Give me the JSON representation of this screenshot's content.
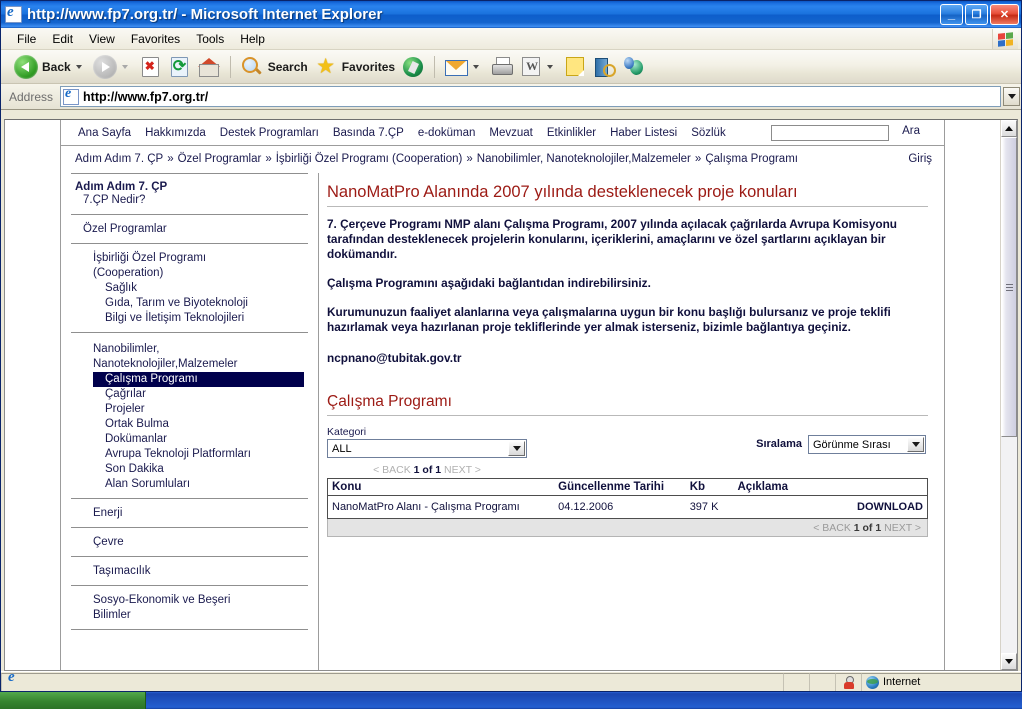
{
  "window": {
    "title": "http://www.fp7.org.tr/ - Microsoft Internet Explorer",
    "icon": "ie-page-icon",
    "minimize_label": "_",
    "maximize_label": "❐",
    "close_label": "✕"
  },
  "menubar": {
    "items": [
      {
        "label": "File"
      },
      {
        "label": "Edit"
      },
      {
        "label": "View"
      },
      {
        "label": "Favorites"
      },
      {
        "label": "Tools"
      },
      {
        "label": "Help"
      }
    ]
  },
  "toolbar": {
    "back_label": "Back",
    "search_label": "Search",
    "favorites_label": "Favorites",
    "icons": [
      "back-icon",
      "forward-icon",
      "stop-icon",
      "refresh-icon",
      "home-icon",
      "search-icon",
      "favorites-star-icon",
      "media-icon",
      "mail-icon",
      "print-icon",
      "edit-word-icon",
      "notes-icon",
      "research-icon",
      "messenger-icon"
    ]
  },
  "addressbar": {
    "label": "Address",
    "url": "http://www.fp7.org.tr/",
    "placeholder": "http://"
  },
  "statusbar": {
    "message": "",
    "zone": "Internet"
  },
  "page": {
    "topnav": [
      {
        "label": "Ana Sayfa"
      },
      {
        "label": "Hakkımızda"
      },
      {
        "label": "Destek Programları"
      },
      {
        "label": "Basında 7.ÇP"
      },
      {
        "label": "e-doküman"
      },
      {
        "label": "Mevzuat"
      },
      {
        "label": "Etkinlikler"
      },
      {
        "label": "Haber Listesi"
      },
      {
        "label": "Sözlük"
      }
    ],
    "search": {
      "value": "",
      "placeholder": "",
      "button_label": "Ara"
    },
    "breadcrumb": {
      "items": [
        "Adım Adım 7. ÇP",
        "Özel Programlar",
        "İşbirliği Özel Programı (Cooperation)",
        "Nanobilimler, Nanoteknolojiler,Malzemeler",
        "Çalışma Programı"
      ],
      "separator": "»"
    },
    "login_label": "Giriş",
    "sidebar": {
      "groups": [
        {
          "head": "Adım Adım 7. ÇP",
          "links": [
            {
              "label": "7.ÇP Nedir?",
              "level": 1,
              "selected": false
            }
          ]
        },
        {
          "head": "",
          "links": [
            {
              "label": "Özel Programlar",
              "level": 1,
              "selected": false
            }
          ]
        },
        {
          "head": "",
          "links": [
            {
              "label": "İşbirliği Özel Programı",
              "level": 2,
              "selected": false
            },
            {
              "label": "(Cooperation)",
              "level": 2,
              "selected": false
            },
            {
              "label": "Sağlık",
              "level": 3,
              "selected": false
            },
            {
              "label": "Gıda, Tarım ve Biyoteknoloji",
              "level": 3,
              "selected": false
            },
            {
              "label": "Bilgi ve İletişim Teknolojileri",
              "level": 3,
              "selected": false
            }
          ]
        },
        {
          "head": "",
          "links": [
            {
              "label": "Nanobilimler,",
              "level": 2,
              "selected": false
            },
            {
              "label": "Nanoteknolojiler,Malzemeler",
              "level": 2,
              "selected": false
            },
            {
              "label": "Çalışma Programı",
              "level": 3,
              "selected": true
            },
            {
              "label": "Çağrılar",
              "level": 3,
              "selected": false
            },
            {
              "label": "Projeler",
              "level": 3,
              "selected": false
            },
            {
              "label": "Ortak Bulma",
              "level": 3,
              "selected": false
            },
            {
              "label": "Dokümanlar",
              "level": 3,
              "selected": false
            },
            {
              "label": "Avrupa Teknoloji Platformları",
              "level": 3,
              "selected": false
            },
            {
              "label": "Son Dakika",
              "level": 3,
              "selected": false
            },
            {
              "label": "Alan Sorumluları",
              "level": 3,
              "selected": false
            }
          ]
        },
        {
          "head": "",
          "links": [
            {
              "label": "Enerji",
              "level": 2,
              "selected": false
            }
          ]
        },
        {
          "head": "",
          "links": [
            {
              "label": "Çevre",
              "level": 2,
              "selected": false
            }
          ]
        },
        {
          "head": "",
          "links": [
            {
              "label": "Taşımacılık",
              "level": 2,
              "selected": false
            }
          ]
        },
        {
          "head": "",
          "links": [
            {
              "label": "Sosyo-Ekonomik ve Beşeri",
              "level": 2,
              "selected": false
            },
            {
              "label": "Bilimler",
              "level": 2,
              "selected": false
            }
          ]
        }
      ]
    },
    "main": {
      "title": "NanoMatPro Alanında 2007 yılında desteklenecek proje konuları",
      "paragraphs": [
        "7. Çerçeve Programı NMP alanı Çalışma Programı, 2007 yılında açılacak çağrılarda Avrupa Komisyonu tarafından desteklenecek projelerin konularını, içeriklerini, amaçlarını ve özel şartlarını açıklayan bir dokümandır.",
        "Çalışma Programını aşağıdaki bağlantıdan indirebilirsiniz.",
        "Kurumunuzun  faaliyet alanlarına veya çalışmalarına uygun bir konu başlığı bulursanız ve proje teklifi hazırlamak veya hazırlanan proje tekliflerinde yer almak isterseniz, bizimle bağlantıya geçiniz."
      ],
      "email": "ncpnano@tubitak.gov.tr",
      "section_title": "Çalışma Programı",
      "filters": {
        "category_label": "Kategori",
        "category_value": "ALL",
        "sort_label": "Sıralama",
        "sort_value": "Görünme Sırası"
      },
      "pager_top": {
        "back": "< BACK",
        "position": "1 of 1",
        "next": "NEXT >"
      },
      "pager_bottom": {
        "back": "< BACK",
        "position": "1 of 1",
        "next": "NEXT >"
      },
      "table": {
        "headers": [
          "Konu",
          "Güncellenme Tarihi",
          "Kb",
          "Açıklama",
          ""
        ],
        "rows": [
          {
            "konu": "NanoMatPro Alanı - Çalışma Programı",
            "tarih": "04.12.2006",
            "kb": "397 K",
            "aciklama": "",
            "action": "DOWNLOAD"
          }
        ]
      }
    }
  },
  "colors": {
    "heading_red": "#9c1a14",
    "link_navy": "#1a1a4e",
    "selected_bg": "#00004c",
    "title_blue": "#1464cd"
  }
}
